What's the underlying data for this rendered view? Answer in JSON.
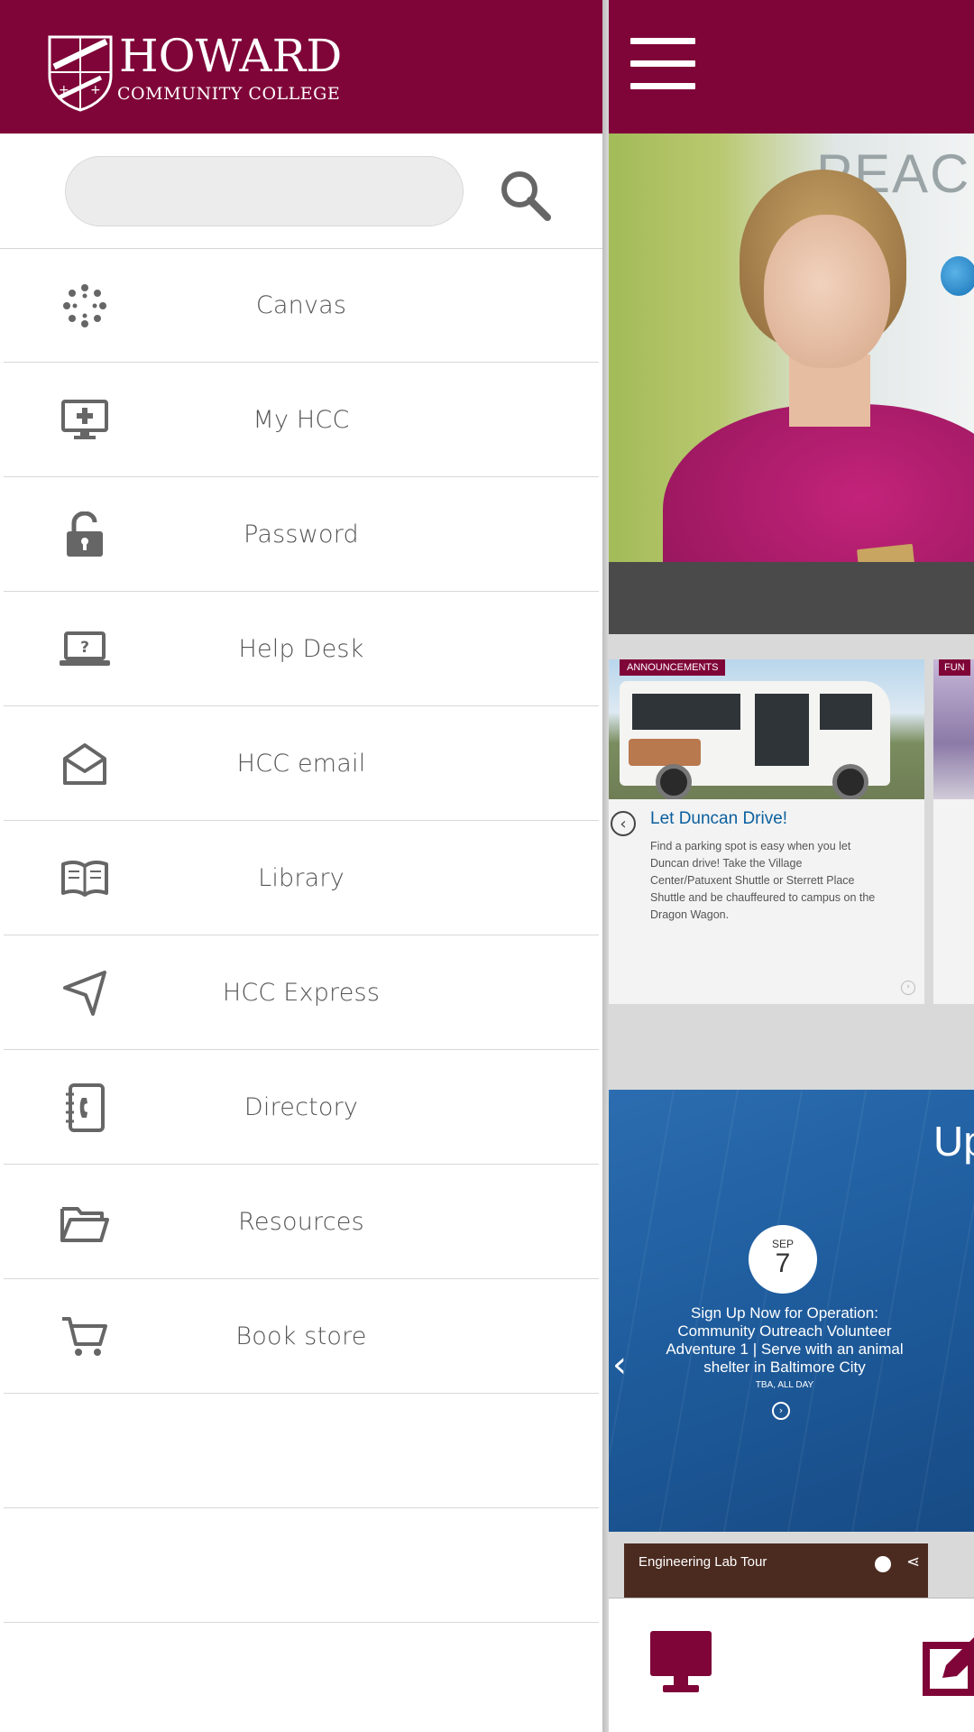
{
  "app": {
    "name": "Howard Community College"
  },
  "logo": {
    "line1": "HOWARD",
    "line2": "COMMUNITY COLLEGE"
  },
  "search": {
    "placeholder": "",
    "value": "",
    "button_icon": "search-icon"
  },
  "menu": {
    "items": [
      {
        "label": "Canvas",
        "icon": "canvas-icon"
      },
      {
        "label": "My HCC",
        "icon": "monitor-plus-icon"
      },
      {
        "label": "Password",
        "icon": "unlock-icon"
      },
      {
        "label": "Help Desk",
        "icon": "laptop-help-icon"
      },
      {
        "label": "HCC email",
        "icon": "envelope-open-icon"
      },
      {
        "label": "Library",
        "icon": "book-icon"
      },
      {
        "label": "HCC Express",
        "icon": "navigation-arrow-icon"
      },
      {
        "label": "Directory",
        "icon": "address-book-icon"
      },
      {
        "label": "Resources",
        "icon": "folder-icon"
      },
      {
        "label": "Book store",
        "icon": "shopping-cart-icon"
      }
    ]
  },
  "main": {
    "hero_sign_text": "PEACH H",
    "news": {
      "tag": "ANNOUNCEMENTS",
      "title": "Let Duncan Drive!",
      "body": "Find a parking spot is easy when you let Duncan drive! Take the Village Center/Patuxent Shuttle or Sterrett Place Shuttle and be chauffeured to campus on the Dragon Wagon.",
      "next_tag": "FUN"
    },
    "events": {
      "heading": "Up",
      "month": "SEP",
      "day": "7",
      "title": "Sign Up Now for Operation: Community Outreach Volunteer Adventure 1 | Serve with an animal shelter in Baltimore City",
      "time": "TBA, ALL DAY"
    },
    "video": {
      "title": "Engineering Lab Tour"
    }
  },
  "colors": {
    "brand": "#7f0538",
    "menu_text": "#555555",
    "icon": "#666666",
    "link": "#0a5f9e",
    "events_bg": "#1f5d9e"
  }
}
